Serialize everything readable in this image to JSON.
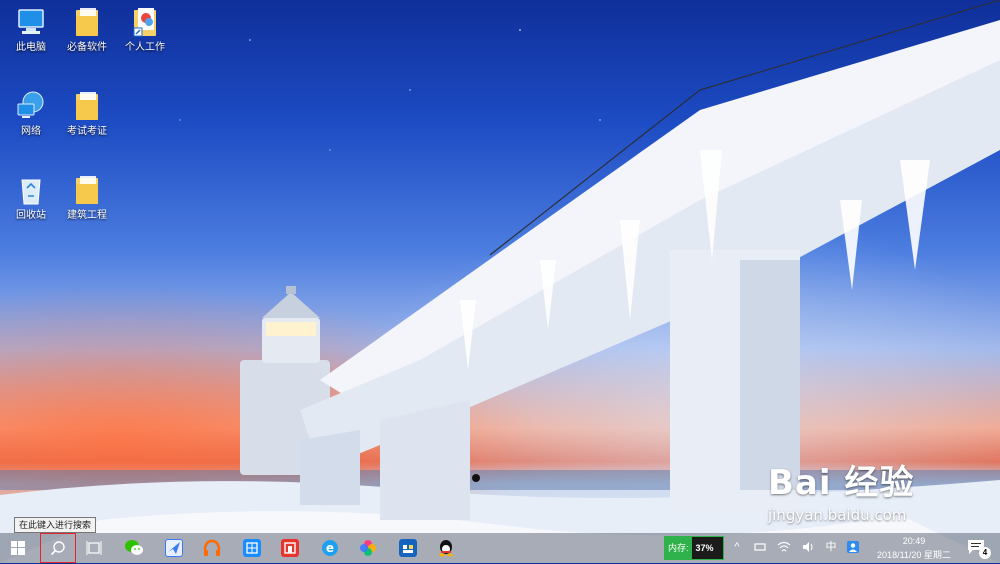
{
  "desktop": {
    "icons": [
      {
        "label": "此电脑",
        "icon": "computer-icon"
      },
      {
        "label": "必备软件",
        "icon": "folder-icon"
      },
      {
        "label": "个人工作",
        "icon": "folder-shortcut-icon"
      },
      {
        "label": "网络",
        "icon": "network-icon"
      },
      {
        "label": "考试考证",
        "icon": "folder-icon"
      },
      {
        "label": "回收站",
        "icon": "recycle-bin-icon"
      },
      {
        "label": "建筑工程",
        "icon": "folder-icon"
      }
    ]
  },
  "tooltip": {
    "text": "在此键入进行搜索"
  },
  "watermark": {
    "logo_text": "Bai 经验",
    "url": "jingyan.baidu.com"
  },
  "taskbar": {
    "apps": [
      {
        "name": "start-button",
        "icon": "windows-logo-icon"
      },
      {
        "name": "search-button",
        "icon": "search-icon"
      },
      {
        "name": "task-view-button",
        "icon": "task-view-icon"
      },
      {
        "name": "wechat-app",
        "icon": "wechat-icon",
        "color": "#2dc100"
      },
      {
        "name": "feishu-app",
        "icon": "bird-app-icon",
        "color": "#3a7bf5"
      },
      {
        "name": "music-app",
        "icon": "headphones-icon",
        "color": "#ff6a00"
      },
      {
        "name": "box-app",
        "icon": "cube-icon",
        "color": "#1a8cff"
      },
      {
        "name": "reader-app",
        "icon": "reader-icon",
        "color": "#e8342e"
      },
      {
        "name": "browser-app",
        "icon": "ie-browser-icon",
        "color": "#1ea0f0"
      },
      {
        "name": "photos-app",
        "icon": "color-wheel-icon",
        "color": "#ff3b7f"
      },
      {
        "name": "store-app",
        "icon": "store-icon",
        "color": "#1565c0"
      },
      {
        "name": "qq-app",
        "icon": "qq-penguin-icon",
        "color": "#111111"
      }
    ],
    "memory": {
      "label": "内存:",
      "value": "37%",
      "color": "#2fb24b"
    },
    "tray": {
      "chevron": "^",
      "ime": "中",
      "notification_count": "4"
    },
    "clock": {
      "time": "20:49",
      "date": "2018/11/20 星期二"
    }
  }
}
